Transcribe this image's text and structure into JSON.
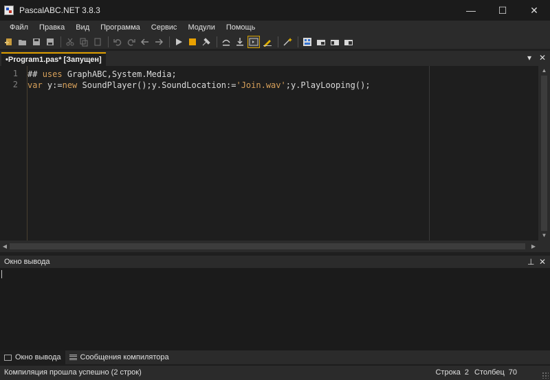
{
  "window": {
    "title": "PascalABC.NET 3.8.3",
    "controls": {
      "minimize": "—",
      "maximize": "☐",
      "close": "✕"
    }
  },
  "menu": [
    "Файл",
    "Правка",
    "Вид",
    "Программа",
    "Сервис",
    "Модули",
    "Помощь"
  ],
  "toolbar_icons": [
    "new-file-icon",
    "open-folder-icon",
    "save-icon",
    "save-all-icon",
    "cut-icon",
    "copy-icon",
    "paste-icon",
    "undo-icon",
    "redo-icon",
    "nav-back-icon",
    "nav-forward-icon",
    "run-icon",
    "stop-icon",
    "build-icon",
    "step-over-icon",
    "step-into-icon",
    "output-console-icon",
    "format-icon",
    "wizard-icon",
    "form-designer-icon",
    "window-1-icon",
    "window-2-icon",
    "window-3-icon"
  ],
  "editor": {
    "tab_label": "•Program1.pas* [Запущен]",
    "tab_close": "✕",
    "tab_menu": "▾",
    "line_numbers": [
      "1",
      "2"
    ],
    "lines": [
      [
        {
          "t": "## ",
          "c": "plain"
        },
        {
          "t": "uses",
          "c": "kw"
        },
        {
          "t": " GraphABC,System.Media;",
          "c": "plain"
        }
      ],
      [
        {
          "t": "var",
          "c": "kw"
        },
        {
          "t": " y:=",
          "c": "plain"
        },
        {
          "t": "new",
          "c": "kw"
        },
        {
          "t": " SoundPlayer();y.SoundLocation:=",
          "c": "plain"
        },
        {
          "t": "'Join.wav'",
          "c": "str"
        },
        {
          "t": ";y.PlayLooping();",
          "c": "plain"
        }
      ]
    ]
  },
  "output_panel": {
    "title": "Окно вывода",
    "pin": "⊥",
    "close": "✕"
  },
  "bottom_tabs": [
    "Окно вывода",
    "Сообщения компилятора"
  ],
  "status": {
    "message": "Компиляция прошла успешно (2 строк)",
    "row_label": "Строка",
    "row_value": "2",
    "col_label": "Столбец",
    "col_value": "70"
  },
  "colors": {
    "background": "#1e1e1e",
    "panel": "#2b2b2b",
    "keyword": "#d7a05a",
    "tab_accent": "#e0a000",
    "line_numbers": "#808080"
  }
}
